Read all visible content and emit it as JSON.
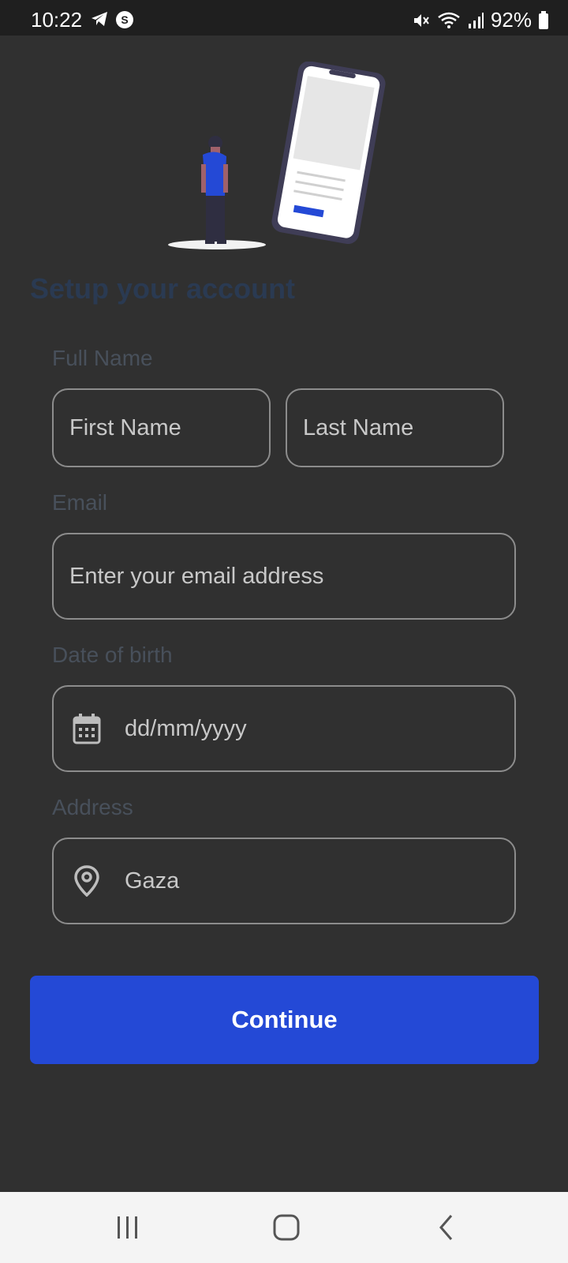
{
  "status": {
    "time": "10:22",
    "battery": "92%",
    "icons": [
      "telegram-icon",
      "shazam-icon",
      "mute-icon",
      "wifi-icon",
      "signal-icon",
      "battery-icon"
    ]
  },
  "form": {
    "title": "Setup your account",
    "full_name": {
      "label": "Full Name",
      "first_placeholder": "First Name",
      "last_placeholder": "Last Name"
    },
    "email": {
      "label": "Email",
      "placeholder": "Enter your email address"
    },
    "dob": {
      "label": "Date of birth",
      "placeholder": "dd/mm/yyyy"
    },
    "address": {
      "label": "Address",
      "value": "Gaza"
    },
    "continue_label": "Continue"
  },
  "nav": {
    "buttons": [
      "recent-apps",
      "home",
      "back"
    ]
  },
  "colors": {
    "background": "#303030",
    "accent": "#2449d6",
    "heading": "#2a3a52",
    "label": "#48505b"
  }
}
